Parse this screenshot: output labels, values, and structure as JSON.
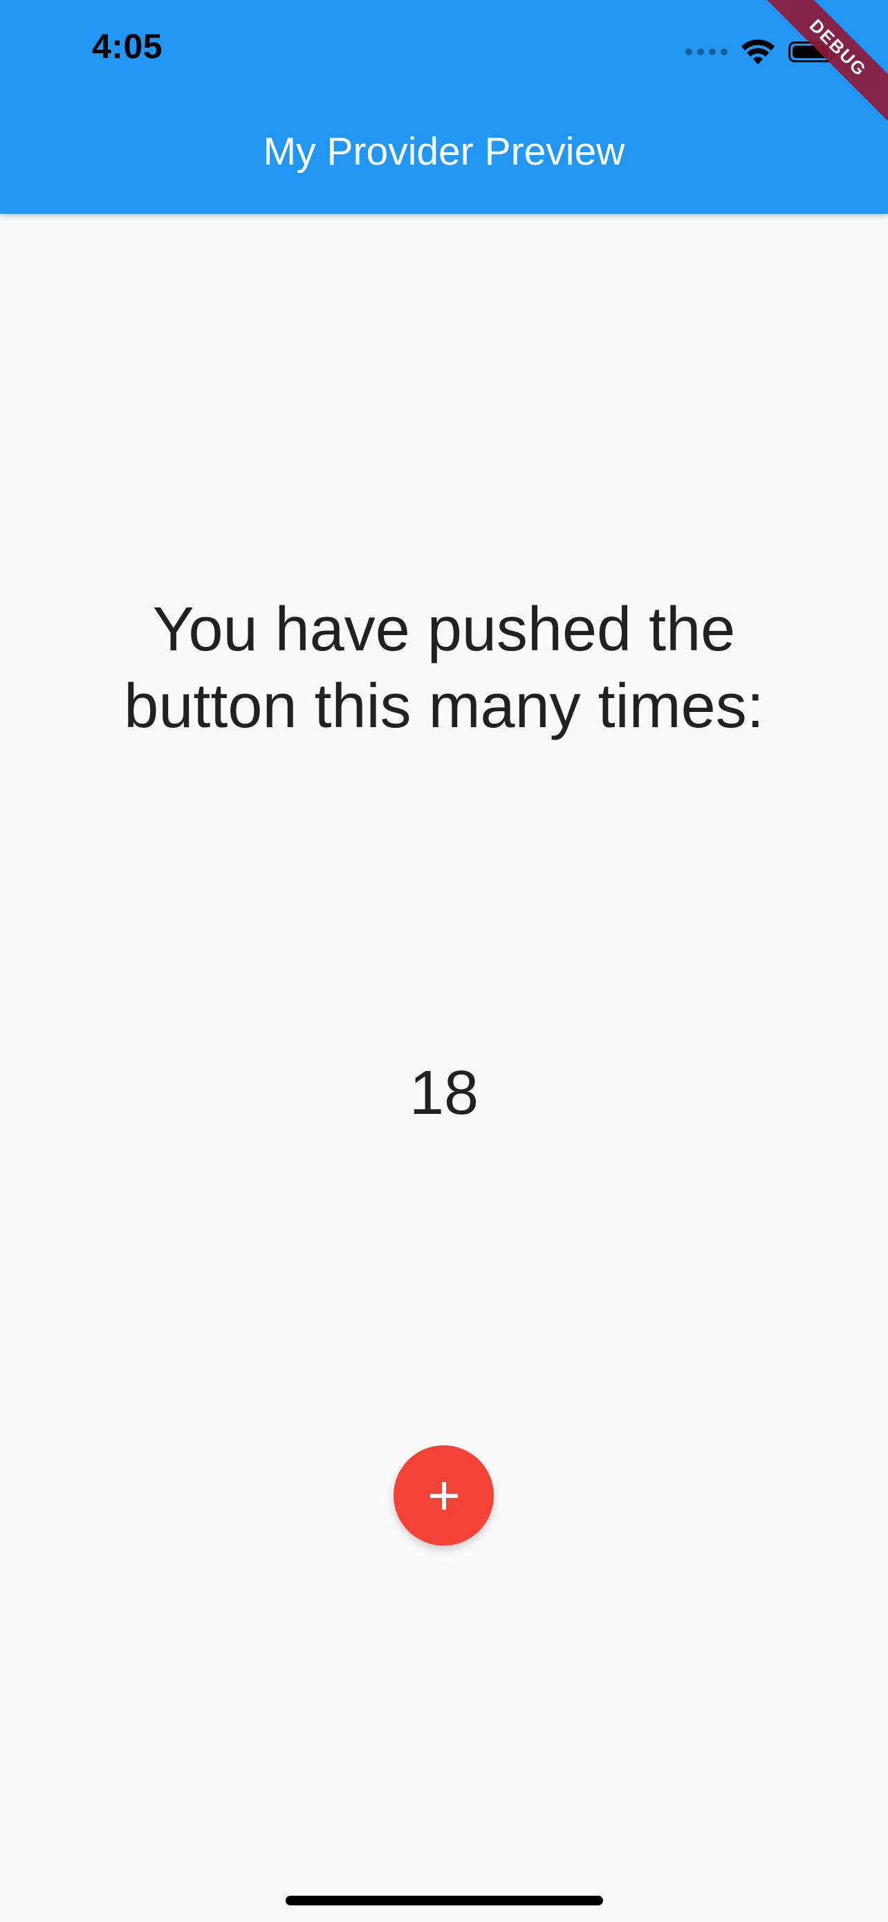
{
  "status_bar": {
    "time": "4:05",
    "icons": [
      "signal-dots-icon",
      "wifi-icon",
      "battery-icon"
    ]
  },
  "app_bar": {
    "title": "My Provider Preview",
    "color": "#2196f3"
  },
  "debug_banner": {
    "label": "DEBUG",
    "color": "#8c1b38"
  },
  "body": {
    "message": "You have pushed the button this many times:",
    "counter": "18"
  },
  "fab": {
    "icon": "plus-icon",
    "color": "#f44336"
  }
}
